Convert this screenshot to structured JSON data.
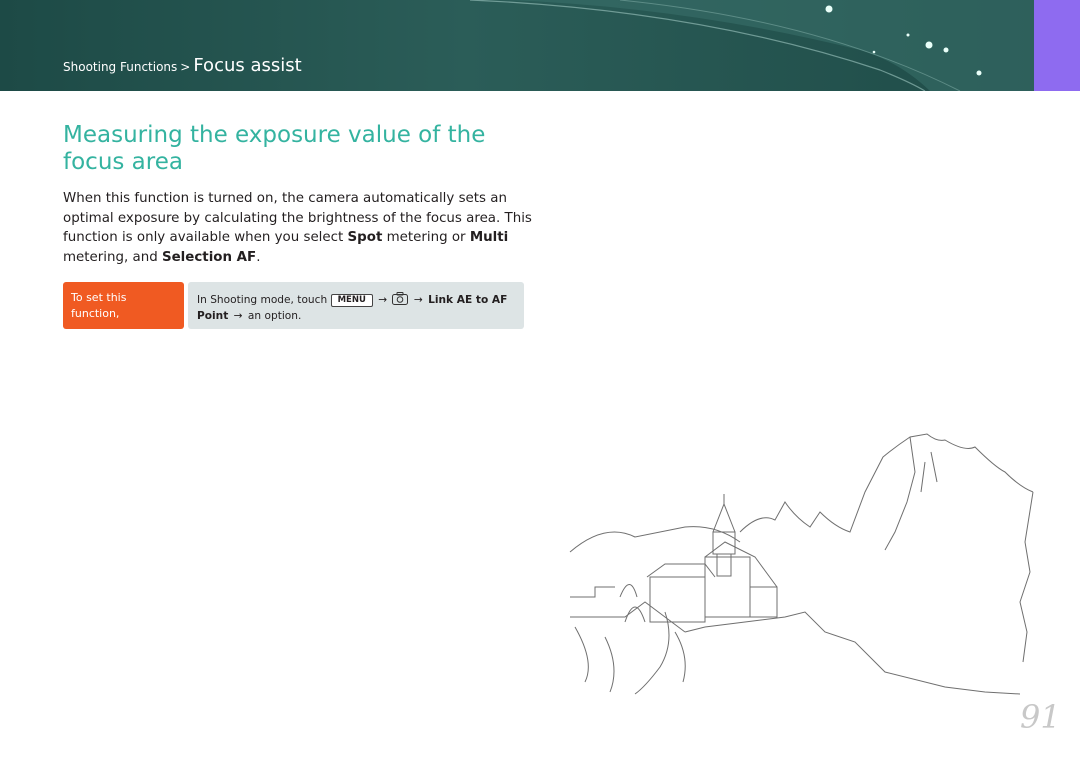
{
  "header": {
    "section": "Shooting Functions",
    "separator": ">",
    "current": "Focus assist"
  },
  "main": {
    "title": "Measuring the exposure value of the focus area",
    "body": {
      "p1": "When this function is turned on, the camera automatically sets an optimal exposure by calculating the brightness of the focus area. This function is only available when you select ",
      "b1": "Spot",
      "p2": " metering or ",
      "b2": "Multi",
      "p3": " metering, and ",
      "b3": "Selection AF",
      "p4": "."
    }
  },
  "howto": {
    "label": "To set this function,",
    "prefix": "In Shooting mode, touch",
    "menu_key": "MENU",
    "arrow": "→",
    "camera_icon": "camera-settings-icon",
    "option_path": "Link AE to AF Point",
    "suffix": "an option."
  },
  "footer": {
    "page_number": "91"
  },
  "colors": {
    "header_bg": "#2b5d58",
    "side_tab": "#8e6bf0",
    "title": "#34b3a0",
    "label_bg": "#f05a22",
    "box_bg": "#dde4e5"
  }
}
